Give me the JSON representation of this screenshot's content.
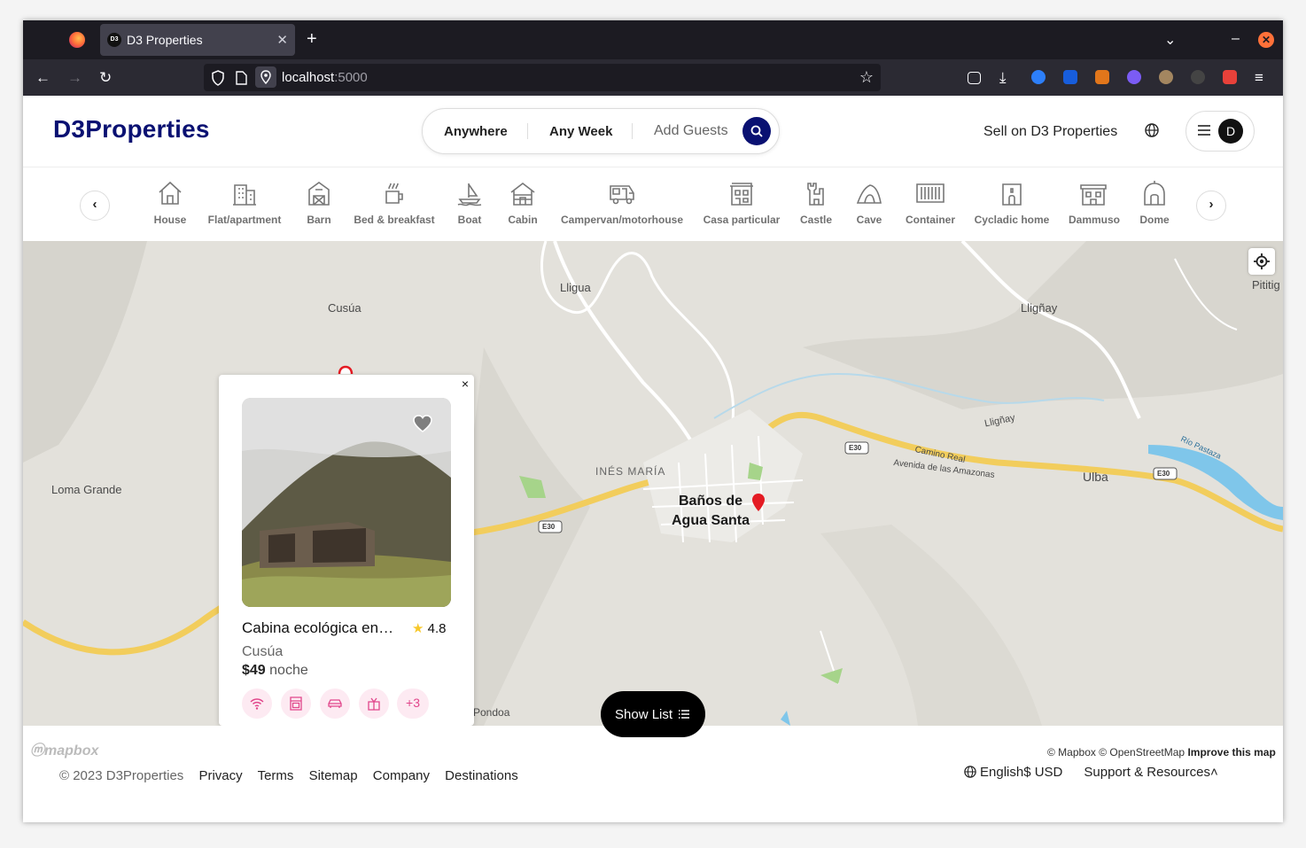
{
  "browser": {
    "tab_title": "D3 Properties",
    "tab_favicon_text": "D3",
    "url_host": "localhost",
    "url_port": ":5000"
  },
  "header": {
    "logo": "D3Properties",
    "search": {
      "where": "Anywhere",
      "when": "Any Week",
      "guests": "Add Guests"
    },
    "sell_link": "Sell on D3 Properties",
    "avatar_initial": "D"
  },
  "categories": [
    {
      "label": "House",
      "icon": "house-icon"
    },
    {
      "label": "Flat/apartment",
      "icon": "building-icon"
    },
    {
      "label": "Barn",
      "icon": "barn-icon"
    },
    {
      "label": "Bed & breakfast",
      "icon": "mug-icon"
    },
    {
      "label": "Boat",
      "icon": "boat-icon"
    },
    {
      "label": "Cabin",
      "icon": "cabin-icon"
    },
    {
      "label": "Campervan/motorhouse",
      "icon": "campervan-icon"
    },
    {
      "label": "Casa particular",
      "icon": "casa-icon"
    },
    {
      "label": "Castle",
      "icon": "castle-icon"
    },
    {
      "label": "Cave",
      "icon": "cave-icon"
    },
    {
      "label": "Container",
      "icon": "container-icon"
    },
    {
      "label": "Cycladic home",
      "icon": "cycladic-icon"
    },
    {
      "label": "Dammuso",
      "icon": "dammuso-icon"
    },
    {
      "label": "Dome",
      "icon": "dome-icon"
    }
  ],
  "map": {
    "labels": {
      "cusua": "Cusúa",
      "lligua": "Lligua",
      "llighay": "Lligñay",
      "llighay2": "Lligñay",
      "loma": "Loma Grande",
      "ines": "INÉS MARÍA",
      "camino": "Camino Real",
      "avenida": "Avenida de las Amazonas",
      "ulba": "Ulba",
      "pondoa": "Pondoa",
      "pititig": "Pititig",
      "rio": "Río Pastaza",
      "e30a": "E30",
      "e30b": "E30",
      "e30c": "E30",
      "city_line1": "Baños de",
      "city_line2": "Agua Santa"
    },
    "attribution": "© Mapbox © OpenStreetMap",
    "improve": "Improve this map",
    "mapbox_logo": "mapbox"
  },
  "listing": {
    "title": "Cabina ecológica en Baños",
    "rating": "4.8",
    "location": "Cusúa",
    "price": "$49",
    "price_unit": "noche",
    "amenities": [
      "wifi-icon",
      "oven-icon",
      "car-icon",
      "gift-icon"
    ],
    "more": "+3",
    "close": "×"
  },
  "show_list": "Show List",
  "footer": {
    "copyright": "© 2023 D3Properties",
    "links": [
      "Privacy",
      "Terms",
      "Sitemap",
      "Company",
      "Destinations"
    ],
    "language": "English",
    "currency": "$ USD",
    "support": "Support & Resources"
  }
}
